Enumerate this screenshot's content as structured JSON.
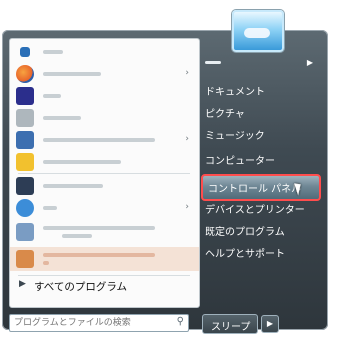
{
  "left_panel": {
    "programs": [
      {
        "icon": "app-icon-1",
        "color": "#2a6fb7"
      },
      {
        "icon": "firefox-icon",
        "color": "#e8642b"
      },
      {
        "icon": "app-icon-3",
        "color": "#2b2e8c"
      },
      {
        "icon": "app-icon-4",
        "color": "#aeb7bd"
      },
      {
        "icon": "office-icon",
        "color": "#3d6fb0"
      },
      {
        "icon": "visual-studio-icon",
        "color": "#f2c12e"
      },
      {
        "icon": "app-icon-7",
        "color": "#2d3d55"
      },
      {
        "icon": "app-icon-8",
        "color": "#3c8dd8"
      },
      {
        "icon": "analytics-icon",
        "color": "#7a9cc3"
      },
      {
        "icon": "apache-icon",
        "color": "#d98a4a"
      }
    ],
    "all_programs_label": "すべてのプログラム",
    "search_placeholder": "プログラムとファイルの検索"
  },
  "right_panel": {
    "items": [
      {
        "label": "ドキュメント"
      },
      {
        "label": "ピクチャ"
      },
      {
        "label": "ミュージック"
      },
      {
        "label": "コンピューター"
      },
      {
        "label": "コントロール パネル"
      },
      {
        "label": "デバイスとプリンター"
      },
      {
        "label": "既定のプログラム"
      },
      {
        "label": "ヘルプとサポート"
      }
    ],
    "highlighted_index": 4,
    "sleep_label": "スリープ"
  },
  "colors": {
    "highlight_border": "#ff4d4d"
  }
}
